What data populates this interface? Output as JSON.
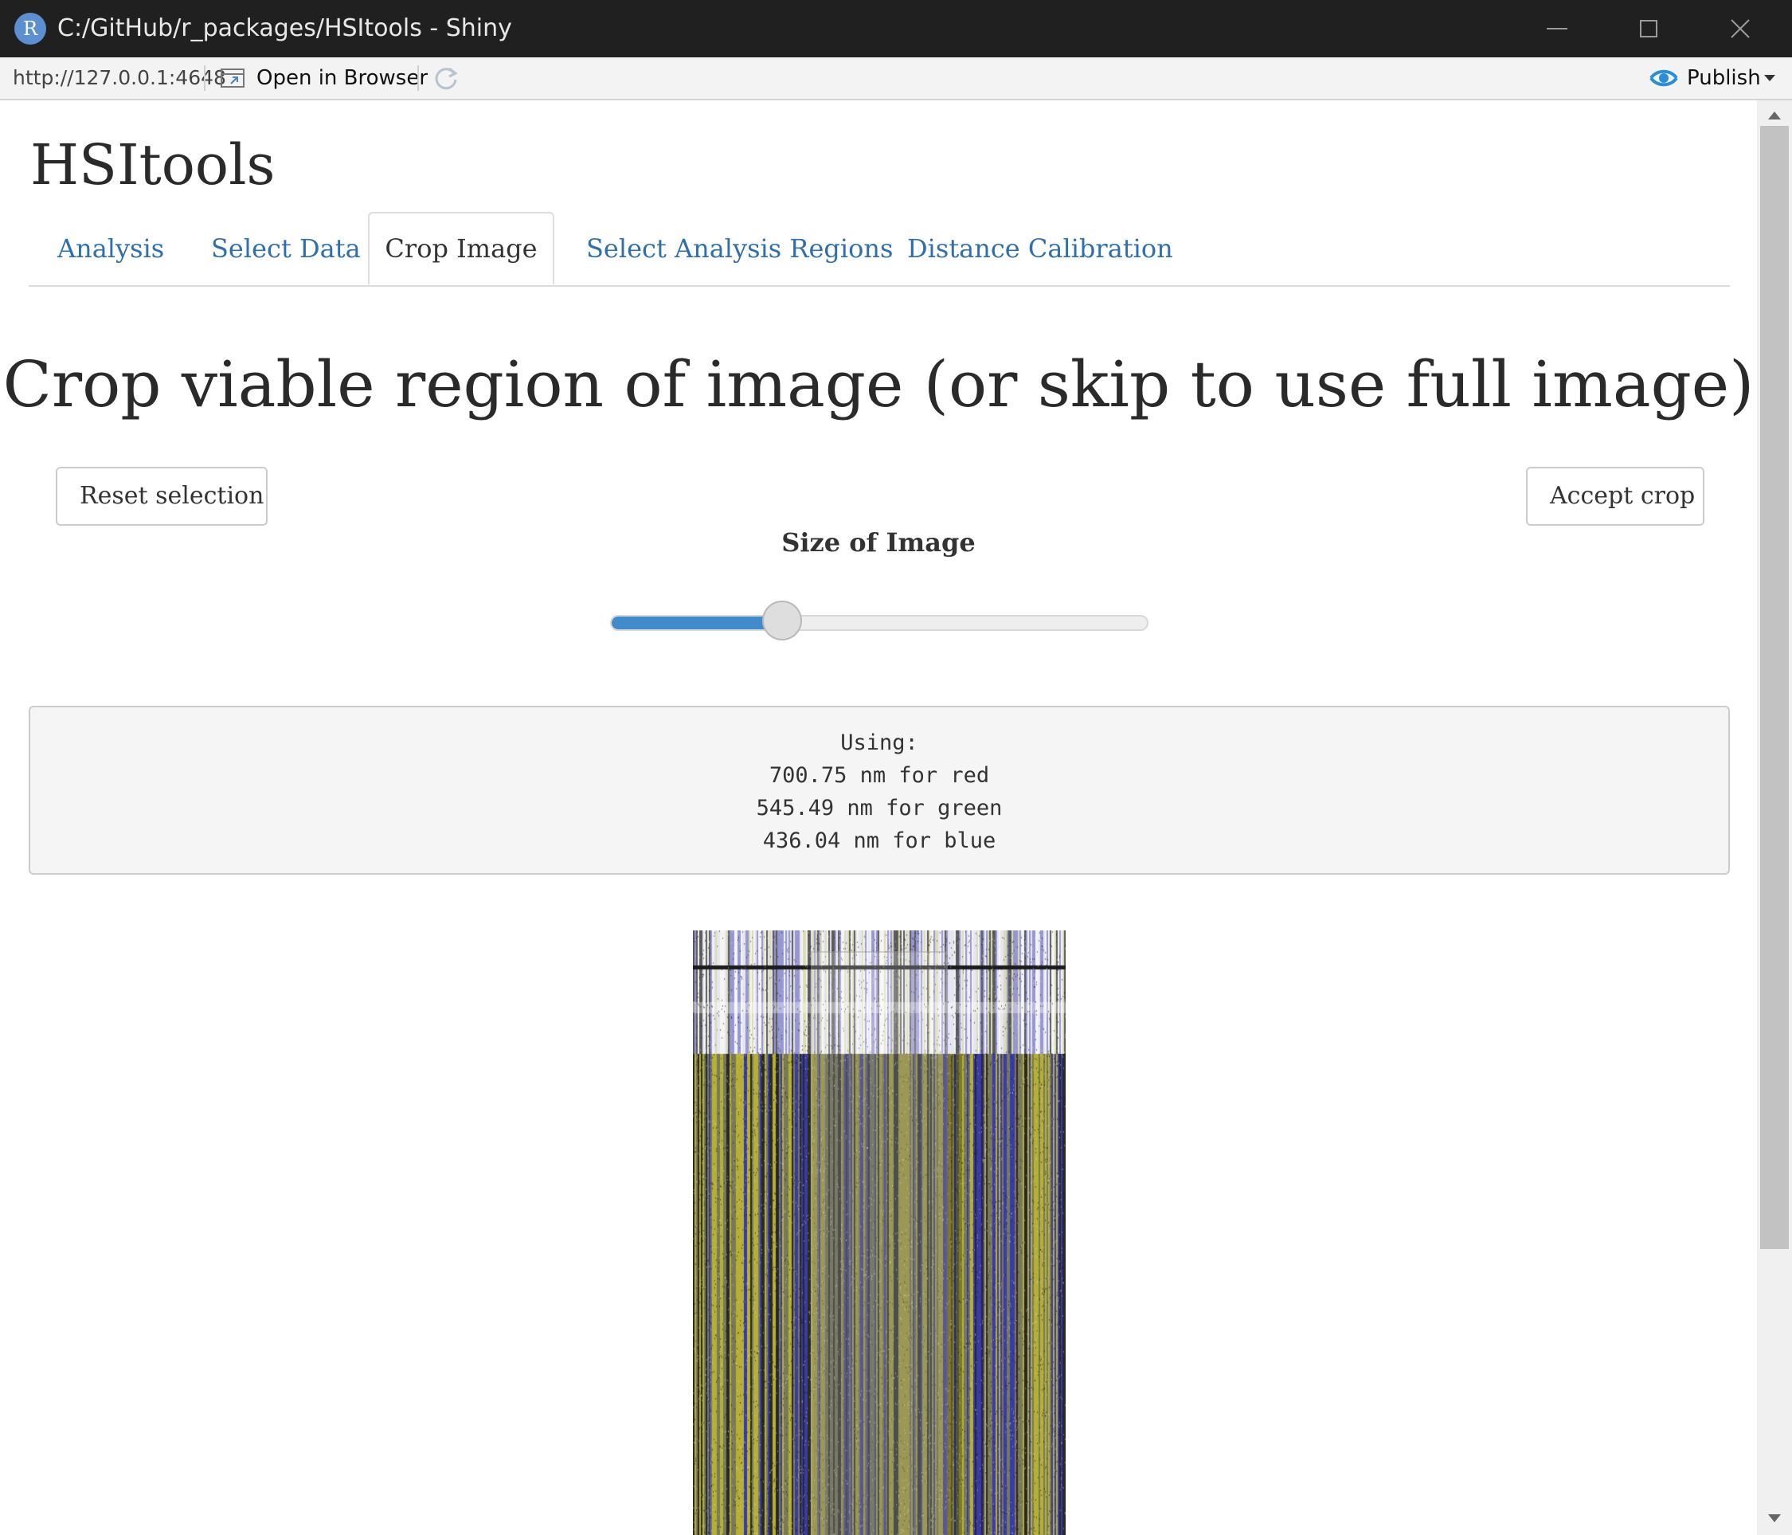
{
  "window": {
    "title": "C:/GitHub/r_packages/HSItools - Shiny",
    "icon_letter": "R"
  },
  "toolbar": {
    "url": "http://127.0.0.1:4648",
    "open_in_browser": "Open in Browser",
    "publish": "Publish"
  },
  "app": {
    "title": "HSItools",
    "tabs": [
      {
        "label": "Analysis"
      },
      {
        "label": "Select Data"
      },
      {
        "label": "Crop Image",
        "active": true
      },
      {
        "label": "Select Analysis Regions"
      },
      {
        "label": "Distance Calibration"
      }
    ],
    "heading": "Crop viable region of image (or skip to use full image)",
    "reset_button": "Reset selection",
    "accept_button": "Accept crop",
    "slider": {
      "label": "Size of Image",
      "value_fraction": 0.32
    },
    "info": {
      "line1": "Using:",
      "line2": "700.75 nm for red",
      "line3": "545.49 nm for green",
      "line4": "436.04 nm for blue"
    }
  },
  "colors": {
    "link": "#2f6fad",
    "slider_fill": "#428bca",
    "image_yellow": "#b5b035",
    "image_blue": "#3a3aa8"
  }
}
